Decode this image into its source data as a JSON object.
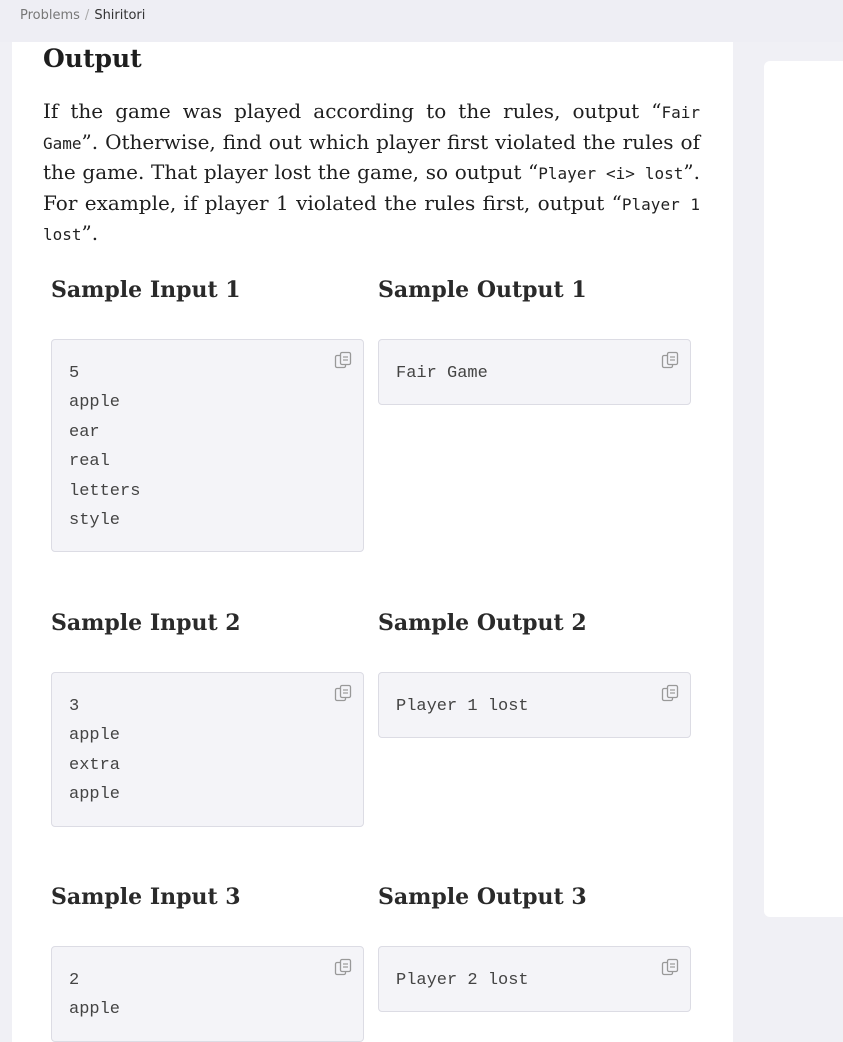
{
  "breadcrumb": {
    "parent": "Problems",
    "separator": "/",
    "current": "Shiritori"
  },
  "output_section": {
    "title": "Output",
    "text_1": "If the game was played according to the rules, output “",
    "code_1": "Fair Game",
    "text_2": "”. Otherwise, find out which player first violated the rules of the game. That player lost the game, so output “",
    "code_2": "Player <i> lost",
    "text_3": "”. For example, if player 1 violated the rules first, output “",
    "code_3": "Player 1 lost",
    "text_4": "”."
  },
  "samples": [
    {
      "input_title": "Sample Input 1",
      "output_title": "Sample Output 1",
      "input": "5\napple\near\nreal\nletters\nstyle",
      "output": "Fair Game"
    },
    {
      "input_title": "Sample Input 2",
      "output_title": "Sample Output 2",
      "input": "3\napple\nextra\napple",
      "output": "Player 1 lost"
    },
    {
      "input_title": "Sample Input 3",
      "output_title": "Sample Output 3",
      "input": "2\napple",
      "output": "Player 2 lost"
    }
  ]
}
